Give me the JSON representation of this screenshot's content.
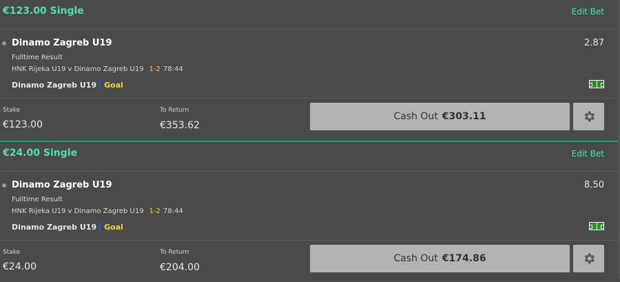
{
  "bets": [
    {
      "title": "€123.00 Single",
      "edit_label": "Edit Bet",
      "selection": {
        "name": "Dinamo Zagreb U19",
        "odds": "2.87",
        "market": "Fulltime Result",
        "event": "HNK Rijeka U19 v Dinamo Zagreb U19",
        "score": "1-2",
        "clock": "78:44",
        "goal_team": "Dinamo Zagreb U19",
        "goal_label": "Goal"
      },
      "stake_label": "Stake",
      "stake_value": "€123.00",
      "return_label": "To Return",
      "return_value": "€353.62",
      "cashout_label": "Cash Out",
      "cashout_amount": "€303.11"
    },
    {
      "title": "€24.00 Single",
      "edit_label": "Edit Bet",
      "selection": {
        "name": "Dinamo Zagreb U19",
        "odds": "8.50",
        "market": "Fulltime Result",
        "event": "HNK Rijeka U19 v Dinamo Zagreb U19",
        "score": "1-2",
        "clock": "78:44",
        "goal_team": "Dinamo Zagreb U19",
        "goal_label": "Goal"
      },
      "stake_label": "Stake",
      "stake_value": "€24.00",
      "return_label": "To Return",
      "return_value": "€204.00",
      "cashout_label": "Cash Out",
      "cashout_amount": "€174.86"
    }
  ],
  "icons": {
    "status": "soccer-pitch-icon",
    "settings": "gear-icon",
    "bullet": "bullet-dot"
  },
  "colors": {
    "accent": "#4fe0b2",
    "separator": "#16a37a",
    "score": "#f5d33a",
    "goal_bar": "#2a4fd6",
    "button": "#b3b3b3",
    "background": "#4a4a4a"
  }
}
